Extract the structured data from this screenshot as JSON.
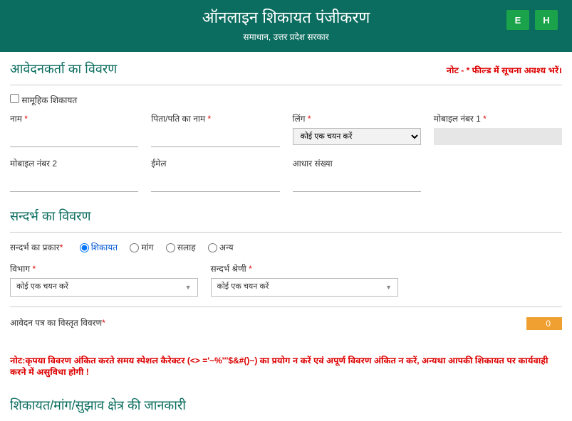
{
  "header": {
    "title": "ऑनलाइन शिकायत पंजीकरण",
    "subtitle": "समाधान, उत्तर प्रदेश सरकार",
    "lang_e": "E",
    "lang_h": "H"
  },
  "section1": {
    "title": "आवेदनकर्ता का विवरण",
    "note_prefix": "नोट - ",
    "note_suffix": " फील्ड में सूचना अवश्य भरें।",
    "checkbox_label": "सामूहिक शिकायत",
    "fields": {
      "name": "नाम",
      "father": "पिता/पति का नाम",
      "gender": "लिंग",
      "gender_placeholder": "कोई एक चयन करें",
      "mobile1": "मोबाइल नंबर 1",
      "mobile2": "मोबाइल नंबर 2",
      "email": "ईमेल",
      "aadhaar": "आधार संख्या"
    }
  },
  "section2": {
    "title": "सन्दर्भ का विवरण",
    "type_label": "सन्दर्भ का प्रकार",
    "radios": {
      "r1": "शिकायत",
      "r2": "मांग",
      "r3": "सलाह",
      "r4": "अन्य"
    },
    "dept_label": "विभाग",
    "dept_placeholder": "कोई एक चयन करें",
    "cat_label": "सन्दर्भ श्रेणी",
    "cat_placeholder": "कोई एक चयन करें",
    "detail_label": "आवेदन पत्र का विस्तृत विवरण",
    "char_count": "0"
  },
  "warn": "नोट:कृपया विवरण अंकित करते समय स्पेशल कैरेक्टर (<> ='~%'''$&#()~) का प्रयोग न करें एवं अपूर्ण विवरण अंकित न करें, अन्यथा आपकी शिकायत पर कार्यवाही करने में असुविधा होगी !",
  "section3": {
    "title": "शिकायत/मांग/सुझाव क्षेत्र की जानकारी"
  }
}
